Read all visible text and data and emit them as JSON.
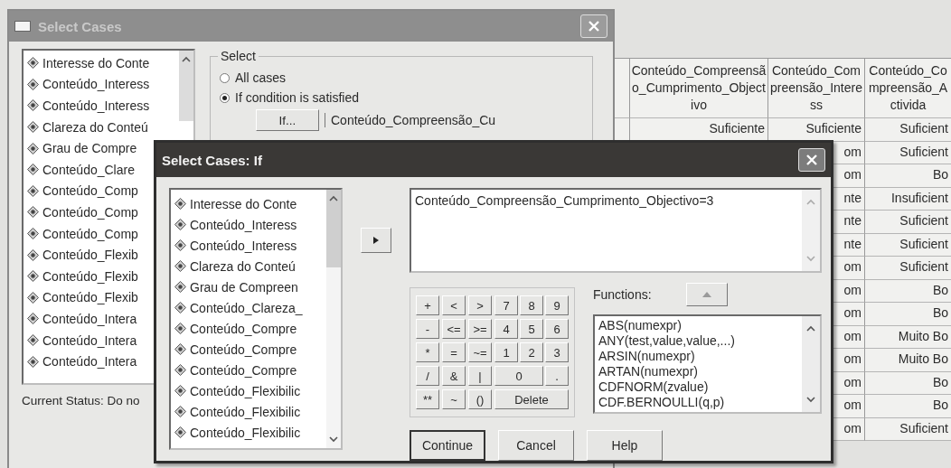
{
  "data_grid": {
    "columns": [
      "Conteúdo_Compreensão_Cumprimento_Objectivo",
      "Conteúdo_Compreensão_Interess",
      "Conteúdo_Compreensão_Activida"
    ],
    "rows": [
      {
        "col_2": "Suficiente",
        "col_3": "Suficiente",
        "col_4": "Suficient"
      },
      {
        "col_3": "om",
        "col_4": "Suficient"
      },
      {
        "col_3": "om",
        "col_4": "Bo"
      },
      {
        "col_3": "nte",
        "col_4": "Insuficient"
      },
      {
        "col_3": "nte",
        "col_4": "Suficient"
      },
      {
        "col_3": "nte",
        "col_4": "Suficient"
      },
      {
        "col_3": "om",
        "col_4": "Suficient"
      },
      {
        "col_3": "om",
        "col_4": "Bo"
      },
      {
        "col_3": "om",
        "col_4": "Bo"
      },
      {
        "col_3": "om",
        "col_4": "Muito Bo"
      },
      {
        "col_3": "om",
        "col_4": "Muito Bo"
      },
      {
        "col_3": "om",
        "col_4": "Bo"
      },
      {
        "col_3": "om",
        "col_4": "Bo"
      },
      {
        "col_3": "om",
        "col_4": "Suficient"
      }
    ]
  },
  "select_cases_dialog": {
    "title": "Select Cases",
    "variables": [
      "Interesse do Conte",
      "Conteúdo_Interess",
      "Conteúdo_Interess",
      "Clareza do Conteú",
      "Grau de Compre",
      "Conteúdo_Clare",
      "Conteúdo_Comp",
      "Conteúdo_Comp",
      "Conteúdo_Comp",
      "Conteúdo_Flexib",
      "Conteúdo_Flexib",
      "Conteúdo_Flexib",
      "Conteúdo_Intera",
      "Conteúdo_Intera",
      "Conteúdo_Intera"
    ],
    "select_group": {
      "label": "Select",
      "options": [
        {
          "label": "All cases",
          "selected": false
        },
        {
          "label": "If condition is satisfied",
          "selected": true
        }
      ],
      "if_button": "If...",
      "condition": "Conteúdo_Compreensão_Cu"
    },
    "current_status": "Current Status: Do no"
  },
  "if_dialog": {
    "title": "Select Cases: If",
    "variables": [
      "Interesse do Conte",
      "Conteúdo_Interess",
      "Conteúdo_Interess",
      "Clareza do Conteú",
      "Grau de Compreen",
      "Conteúdo_Clareza_",
      "Conteúdo_Compre",
      "Conteúdo_Compre",
      "Conteúdo_Compre",
      "Conteúdo_Flexibilic",
      "Conteúdo_Flexibilic",
      "Conteúdo_Flexibilic"
    ],
    "expression": "Conteúdo_Compreensão_Cumprimento_Objectivo=3",
    "keypad": [
      {
        "operators": [
          "+",
          "<",
          ">"
        ],
        "digits": [
          {
            "label": "7",
            "kind": "key"
          },
          {
            "label": "8",
            "kind": "key"
          },
          {
            "label": "9",
            "kind": "key"
          }
        ]
      },
      {
        "operators": [
          "-",
          "<=",
          ">="
        ],
        "digits": [
          {
            "label": "4",
            "kind": "key"
          },
          {
            "label": "5",
            "kind": "key"
          },
          {
            "label": "6",
            "kind": "key"
          }
        ]
      },
      {
        "operators": [
          "*",
          "=",
          "~="
        ],
        "digits": [
          {
            "label": "1",
            "kind": "key"
          },
          {
            "label": "2",
            "kind": "key"
          },
          {
            "label": "3",
            "kind": "key"
          }
        ]
      },
      {
        "operators": [
          "/",
          "&",
          "|"
        ],
        "digits": [
          {
            "label": "0",
            "kind": "wide"
          },
          {
            "label": ".",
            "kind": "key"
          }
        ]
      },
      {
        "operators": [
          "**",
          "~",
          "()"
        ],
        "digits": [
          {
            "label": "Delete",
            "kind": "full"
          }
        ]
      }
    ],
    "functions_label": "Functions:",
    "functions": [
      "ABS(numexpr)",
      "ANY(test,value,value,...)",
      "ARSIN(numexpr)",
      "ARTAN(numexpr)",
      "CDFNORM(zvalue)",
      "CDF.BERNOULLI(q,p)"
    ],
    "buttons": [
      "Continue",
      "Cancel",
      "Help"
    ]
  }
}
